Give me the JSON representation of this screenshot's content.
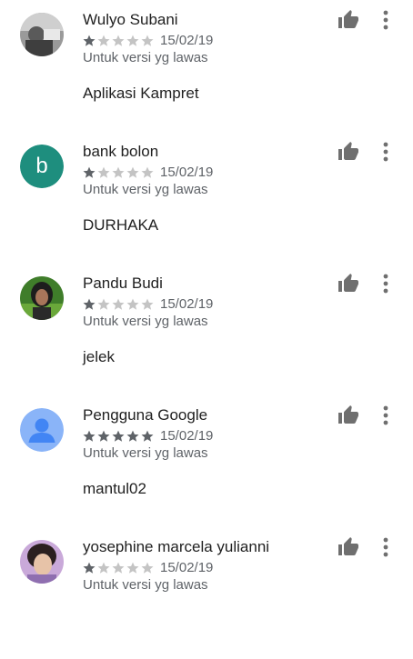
{
  "colors": {
    "star_filled": "#5f6368",
    "star_empty": "#c4c4c4",
    "icon": "#6f6f6f",
    "avatar_b": "#1e8e7e",
    "avatar_google": "#8ab4f8"
  },
  "reviews": [
    {
      "name": "Wulyo Subani",
      "rating": 1,
      "date": "15/02/19",
      "version_note": "Untuk versi yg lawas",
      "text": "Aplikasi Kampret",
      "avatar": "photo"
    },
    {
      "name": "bank bolon",
      "rating": 1,
      "date": "15/02/19",
      "version_note": "Untuk versi yg lawas",
      "text": "DURHAKA",
      "avatar": "letter",
      "avatar_letter": "b"
    },
    {
      "name": "Pandu Budi",
      "rating": 1,
      "date": "15/02/19",
      "version_note": "Untuk versi yg lawas",
      "text": "jelek",
      "avatar": "photo"
    },
    {
      "name": "Pengguna Google",
      "rating": 5,
      "date": "15/02/19",
      "version_note": "Untuk versi yg lawas",
      "text": "mantul02",
      "avatar": "default-user"
    },
    {
      "name": "yosephine marcela yulianni",
      "rating": 1,
      "date": "15/02/19",
      "version_note": "Untuk versi yg lawas",
      "text": "",
      "avatar": "photo"
    }
  ],
  "icons": {
    "like": "thumb-up-icon",
    "more": "more-vert-icon",
    "star": "star-icon"
  }
}
